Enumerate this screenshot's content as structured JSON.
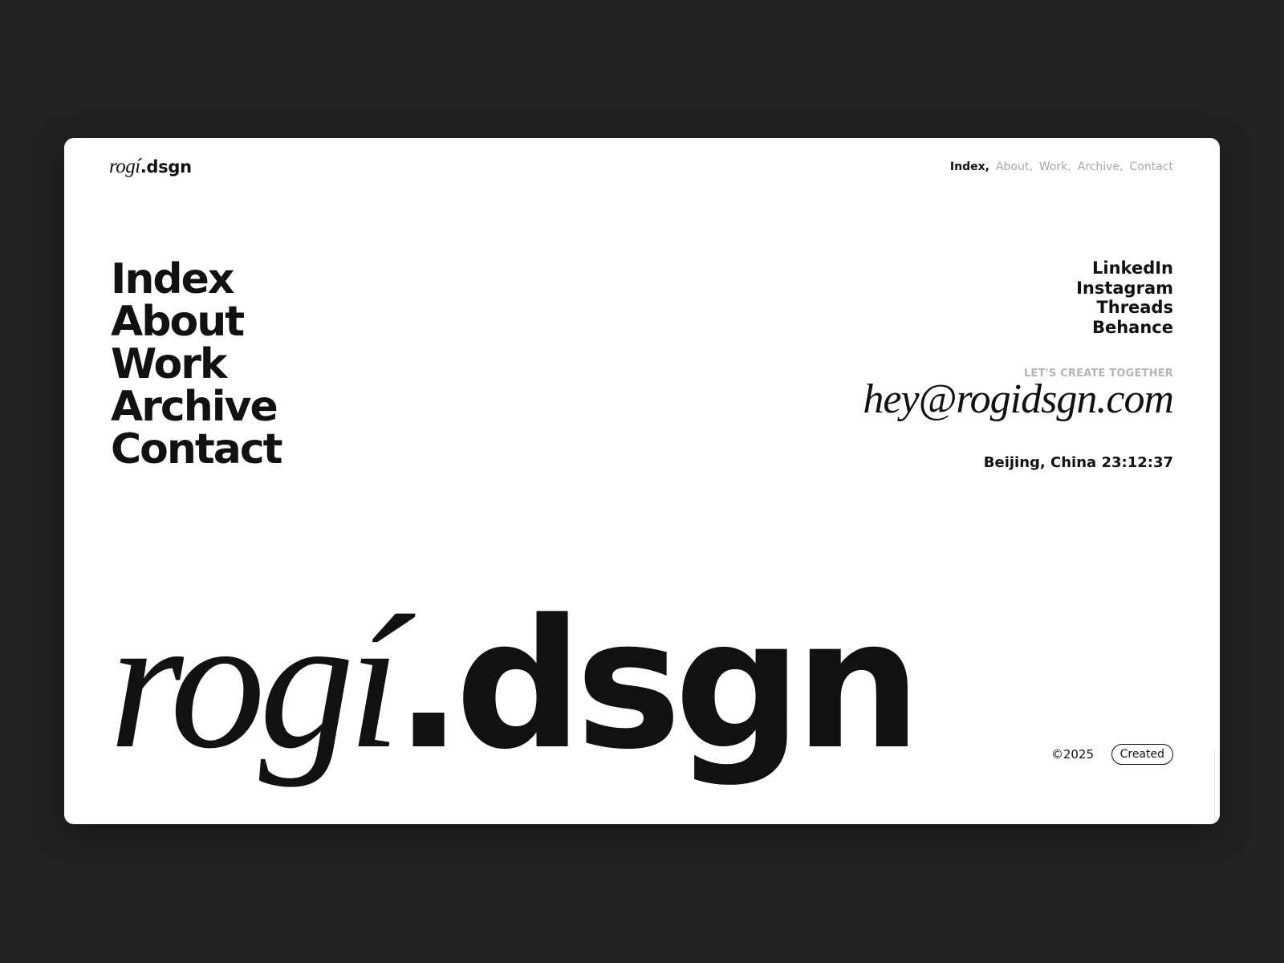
{
  "header": {
    "logo_script": "rogí",
    "logo_sans": ".dsgn",
    "nav": [
      {
        "label": "Index,"
      },
      {
        "label": "About,"
      },
      {
        "label": "Work,"
      },
      {
        "label": "Archive,"
      },
      {
        "label": "Contact"
      }
    ]
  },
  "menu": [
    {
      "label": "Index"
    },
    {
      "label": "About"
    },
    {
      "label": "Work"
    },
    {
      "label": "Archive"
    },
    {
      "label": "Contact"
    }
  ],
  "social": [
    {
      "label": "LinkedIn"
    },
    {
      "label": "Instagram"
    },
    {
      "label": "Threads"
    },
    {
      "label": "Behance"
    }
  ],
  "contact": {
    "tagline": "LET'S CREATE TOGETHER",
    "email": "hey@rogidsgn.com",
    "location": "Beijing, China",
    "time": "23:12:37"
  },
  "hero": {
    "logo_script": "rogí",
    "logo_sans": ".dsgn"
  },
  "footer": {
    "copyright": "©2025",
    "created_label": "Created"
  },
  "colors": {
    "background": "#222222",
    "card": "#ffffff",
    "text": "#111111",
    "muted": "#a8a8a8"
  }
}
